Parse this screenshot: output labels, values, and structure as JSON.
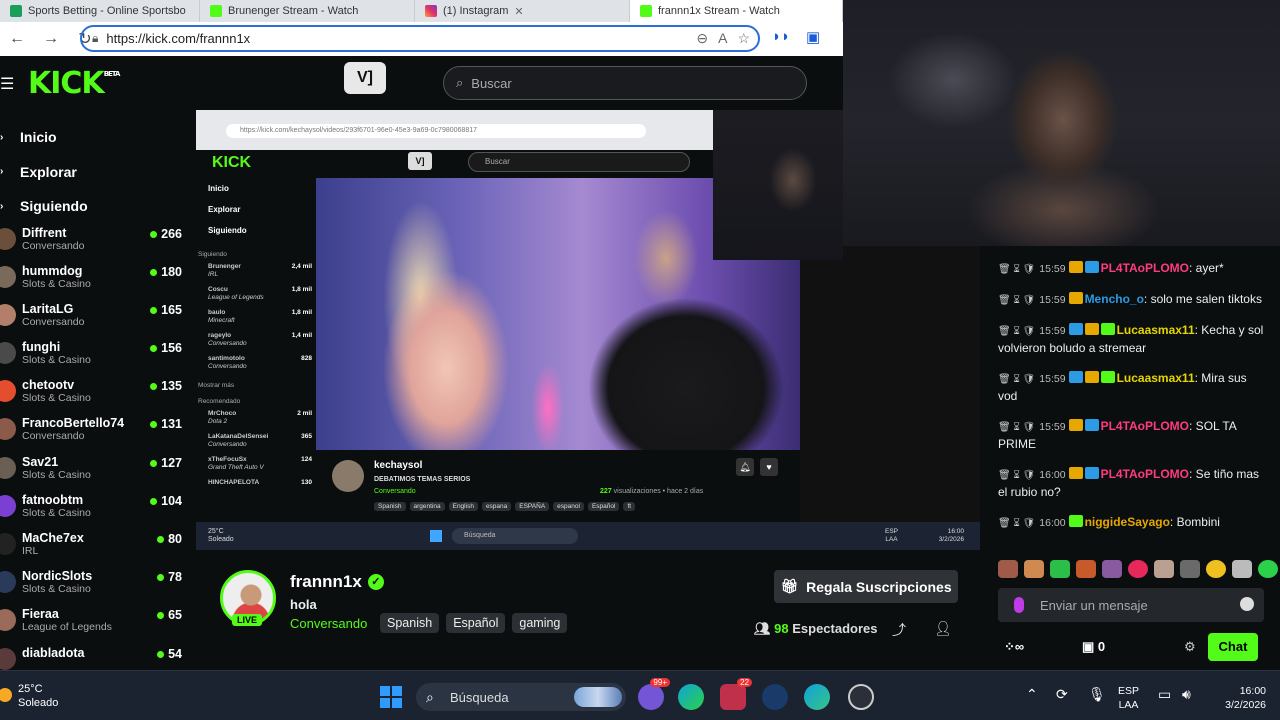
{
  "browser": {
    "tabs": [
      {
        "title": "Sports Betting - Online Sportsbo",
        "active": false
      },
      {
        "title": "Brunenger Stream - Watch",
        "active": false
      },
      {
        "title": "(1) Instagram",
        "active": false
      },
      {
        "title": "frannn1x Stream - Watch",
        "active": true
      }
    ],
    "url": "https://kick.com/frannn1x"
  },
  "header": {
    "logo": "KICK",
    "logo_sup": "BETA",
    "partner_logo": "V]",
    "search_placeholder": "Buscar"
  },
  "sidebar": {
    "nav": [
      {
        "label": "Inicio"
      },
      {
        "label": "Explorar"
      },
      {
        "label": "Siguiendo"
      }
    ],
    "channels": [
      {
        "name": "Diffrent",
        "category": "Conversando",
        "viewers": "266",
        "color": "#6b4f3a"
      },
      {
        "name": "hummdog",
        "category": "Slots & Casino",
        "viewers": "180",
        "color": "#7a6a5a"
      },
      {
        "name": "LaritaLG",
        "category": "Conversando",
        "viewers": "165",
        "color": "#b37f6a"
      },
      {
        "name": "funghi",
        "category": "Slots & Casino",
        "viewers": "156",
        "color": "#4a4a4a"
      },
      {
        "name": "chetootv",
        "category": "Slots & Casino",
        "viewers": "135",
        "color": "#e44d2e"
      },
      {
        "name": "FrancoBertello74",
        "category": "Conversando",
        "viewers": "131",
        "color": "#8b5a4a"
      },
      {
        "name": "Sav21",
        "category": "Slots & Casino",
        "viewers": "127",
        "color": "#6a5f55"
      },
      {
        "name": "fatnoobtm",
        "category": "Slots & Casino",
        "viewers": "104",
        "color": "#7b3fd1"
      },
      {
        "name": "MaChe7ex",
        "category": "IRL",
        "viewers": "80",
        "color": "#222"
      },
      {
        "name": "NordicSlots",
        "category": "Slots & Casino",
        "viewers": "78",
        "color": "#2a3a5a"
      },
      {
        "name": "Fieraa",
        "category": "League of Legends",
        "viewers": "65",
        "color": "#9a6a5a"
      },
      {
        "name": "diabladota",
        "category": "",
        "viewers": "54",
        "color": "#5a3a3a"
      }
    ]
  },
  "inner": {
    "url": "https://kick.com/kechaysol/videos/293f6701-96e0-45e3-9a69-0c7980068817",
    "search": "Buscar",
    "nav": [
      "Inicio",
      "Explorar",
      "Siguiendo"
    ],
    "following_label": "Siguiendo",
    "channels": [
      {
        "name": "Brunenger",
        "cat": "IRL",
        "v": "2,4 mil"
      },
      {
        "name": "Coscu",
        "cat": "League of Legends",
        "v": "1,8 mil"
      },
      {
        "name": "baulo",
        "cat": "Minecraft",
        "v": "1,8 mil"
      },
      {
        "name": "rageylo",
        "cat": "Conversando",
        "v": "1,4 mil"
      },
      {
        "name": "santimotolo",
        "cat": "Conversando",
        "v": "828"
      }
    ],
    "more_label": "Mostrar más",
    "recommended_label": "Recomendado",
    "recommended": [
      {
        "name": "MrChoco",
        "cat": "Dota 2",
        "v": "2 mil"
      },
      {
        "name": "LaKatanaDelSensei",
        "cat": "Conversando",
        "v": "365"
      },
      {
        "name": "xTheFocuSx",
        "cat": "Grand Theft Auto V",
        "v": "124"
      },
      {
        "name": "HINCHAPELOTA",
        "cat": "",
        "v": "130"
      }
    ],
    "streamer": "kechaysol",
    "title": "DEBATIMOS TEMAS SERIOS",
    "category": "Conversando",
    "tags": [
      "Spanish",
      "argentina",
      "English",
      "espana",
      "ESPAÑA",
      "espanol",
      "Español",
      "ft"
    ],
    "views": "227",
    "views_label": "visualizaciones • hace 2 días",
    "taskbar_weather": "25°C",
    "taskbar_weather2": "Soleado",
    "taskbar_search": "Búsqueda",
    "taskbar_lang1": "ESP",
    "taskbar_lang2": "LAA",
    "taskbar_time": "16:00",
    "taskbar_date": "3/2/2026"
  },
  "channel": {
    "name": "frannn1x",
    "title": "hola",
    "category": "Conversando",
    "tags": [
      "Spanish",
      "Español",
      "gaming"
    ],
    "live_label": "LIVE",
    "gift_label": "Regala Suscripciones",
    "viewers": "98",
    "viewers_label": "Espectadores"
  },
  "chat": {
    "messages": [
      {
        "time": "15:59",
        "user": "PL4TAoPLOMO",
        "color": "#ff3b7f",
        "text": ": ayer*",
        "badges": [
          "gold",
          "blue"
        ]
      },
      {
        "time": "15:59",
        "user": "Mencho_o",
        "color": "#2b9be6",
        "text": ": solo me salen tiktoks",
        "badges": [
          "gold"
        ]
      },
      {
        "time": "15:59",
        "user": "Lucaasmax11",
        "color": "#e6d600",
        "text": ": Kecha y sol volvieron boludo a stremear",
        "badges": [
          "blue",
          "gold",
          "green"
        ]
      },
      {
        "time": "15:59",
        "user": "Lucaasmax11",
        "color": "#e6d600",
        "text": ": Mira sus vod",
        "badges": [
          "blue",
          "gold",
          "green"
        ]
      },
      {
        "time": "15:59",
        "user": "PL4TAoPLOMO",
        "color": "#ff3b7f",
        "text": ": SOL TA PRIME",
        "badges": [
          "gold",
          "blue"
        ]
      },
      {
        "time": "16:00",
        "user": "PL4TAoPLOMO",
        "color": "#ff3b7f",
        "text": ": Se tiño mas el rubio no?",
        "badges": [
          "gold",
          "blue"
        ]
      },
      {
        "time": "16:00",
        "user": "niggideSayago",
        "color": "#e6a800",
        "text": ": Bombini",
        "badges": [
          "green"
        ]
      }
    ],
    "input_placeholder": "Enviar un mensaje",
    "points": "∞",
    "count": "0",
    "send_label": "Chat"
  },
  "taskbar": {
    "temp": "25°C",
    "weather": "Soleado",
    "search": "Búsqueda",
    "lang1": "ESP",
    "lang2": "LAA",
    "time": "16:00",
    "date": "3/2/2026",
    "badge_count": "22",
    "notif_count": "99+"
  }
}
